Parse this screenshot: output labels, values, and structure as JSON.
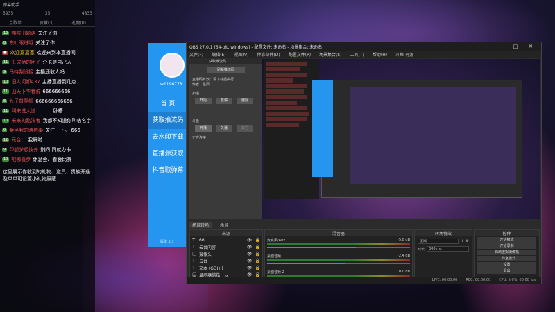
{
  "chat": {
    "header": "弹幕助手",
    "stats": [
      "5935",
      "35",
      "4833"
    ],
    "tabs": [
      "点歌单",
      "贡献(3)",
      "礼物(0)"
    ],
    "messages": [
      {
        "level": "12",
        "user": "唠咳出题遇",
        "text": "关注了你"
      },
      {
        "level": "8",
        "user": "东叶眼进哦",
        "text": "关注了你"
      },
      {
        "level": "",
        "user": "欢迎嘉嘉家",
        "text": "欢迎来到本直播间"
      },
      {
        "level": "11",
        "user": "低成晒的团子",
        "text": "介卡是自己人"
      },
      {
        "level": "9",
        "user": "马特梨没接",
        "text": "主播还收人吗"
      },
      {
        "level": "10",
        "user": "旧人问卸437",
        "text": "主播直播到几点"
      },
      {
        "level": "11",
        "user": "山天下华着说",
        "text": "666666666"
      },
      {
        "level": "8",
        "user": "九子普爬帽",
        "text": "666666666666"
      },
      {
        "level": "11",
        "user": "叫来说大道",
        "text": ". . . . . 卧槽"
      },
      {
        "level": "10",
        "user": "米来的路法者",
        "text": "我都不知道你叫啥名字"
      },
      {
        "level": "9",
        "user": "金民我的晓信奉",
        "text": "关注一下。 666"
      },
      {
        "level": "12",
        "user": "元台：",
        "text": "我解啦"
      },
      {
        "level": "9",
        "user": "印想梦想技养",
        "text": "别问 问就办卡"
      },
      {
        "level": "10",
        "user": "吧哪喜步",
        "text": "休息会、看会比赛"
      }
    ],
    "note": "这里展示你收到的礼物、道具、贵族开通及单单可设置小礼物屏蔽"
  },
  "blueapp": {
    "username": "w1196778",
    "nav": [
      "首 页",
      "获取推流码",
      "去水印下载",
      "直播源获取",
      "抖音取弹幕"
    ],
    "version": "版本 1.3"
  },
  "obs": {
    "title": "OBS 27.0.1 (64-bit, windows) - 配置文件: 未命名 - 场景集合: 未命名",
    "menu": [
      "文件(F)",
      "编辑(E)",
      "视图(V)",
      "停靠部件(D)",
      "配置文件(P)",
      "场景集合(S)",
      "工具(T)",
      "帮助(H)",
      "斗鱼-有源"
    ],
    "dialog": {
      "title": "获取推流码",
      "button_top": "刷新推流码",
      "line1": "直播码有效：请下载后执行",
      "line2": "作者：星辰",
      "section1": "扫描",
      "btn_start": "开始",
      "btn_pause": "暂停",
      "btn_delete": "删除",
      "section2": "斗鱼",
      "btn_open": "开播",
      "btn_stop": "关播",
      "btn_other": "其它",
      "status": "正在连接"
    },
    "tabs": [
      "场景转场",
      "场景"
    ],
    "docks": {
      "sources_title": "来源",
      "mixer_title": "混音器",
      "transitions_title": "转场特效",
      "controls_title": "控件"
    },
    "sources": [
      {
        "icon": "T",
        "name": "66"
      },
      {
        "icon": "T",
        "name": "云台内容"
      },
      {
        "icon": "▢",
        "name": "摄像头"
      },
      {
        "icon": "T",
        "name": "云台"
      },
      {
        "icon": "T",
        "name": "文本 (GDI+)"
      },
      {
        "icon": "▢",
        "name": "显示器捕获"
      }
    ],
    "mixer": [
      {
        "name": "麦克风/Aux",
        "db": "-5.0 dB",
        "level": 0.62
      },
      {
        "name": "桌面音频",
        "db": "-2.4 dB",
        "level": 0.55
      },
      {
        "name": "桌面音频 2",
        "db": "0.0 dB",
        "level": 0.45
      }
    ],
    "transition": {
      "value": "淡出",
      "duration_label": "时长",
      "duration": "300 ms"
    },
    "controls": [
      "开始推流",
      "开始录制",
      "启动虚拟摄像机",
      "工作室模式",
      "设置",
      "退出"
    ],
    "status": {
      "live": "LIVE: 00:00:00",
      "rec": "REC: 00:00:00",
      "cpu": "CPU: 5.0%, 60.00 fps"
    }
  },
  "colors": {
    "accent_blue": "#2596f0",
    "obs_bg": "#2b2b2b"
  }
}
